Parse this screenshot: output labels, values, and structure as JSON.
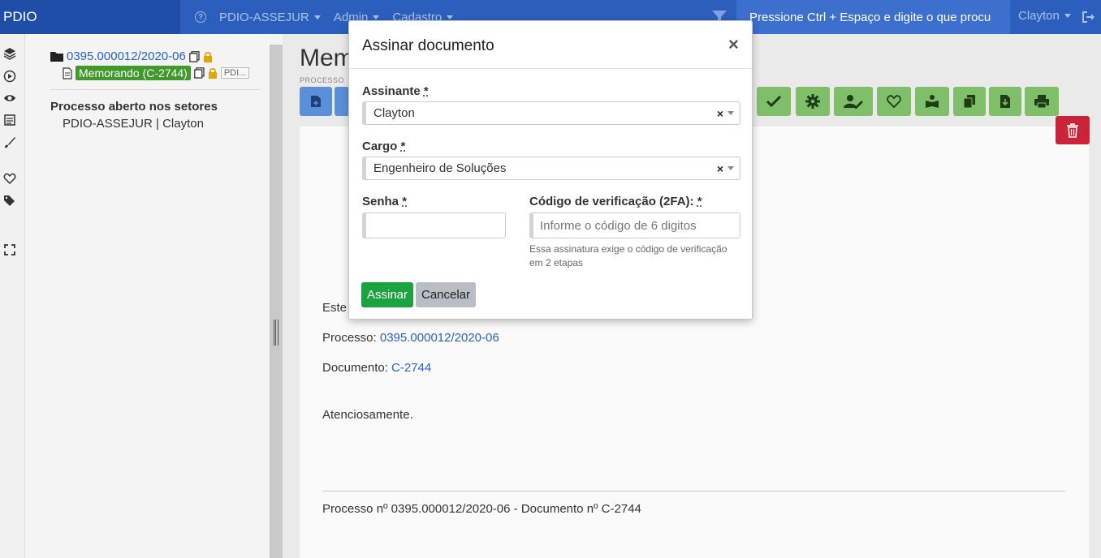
{
  "navbar": {
    "brand": "PDIO",
    "items": [
      {
        "label": "PDIO-ASSEJUR"
      },
      {
        "label": "Admin"
      },
      {
        "label": "Cadastro"
      }
    ],
    "search_text": "Pressione Ctrl + Espaço e digite o que procu",
    "user": "Clayton"
  },
  "tree": {
    "process_number": "0395.000012/2020-06",
    "document_label": "Memorando (C-2744)",
    "document_tag": "PDI...",
    "open_title": "Processo aberto nos setores",
    "sector": "PDIO-ASSEJUR | Clayton"
  },
  "main": {
    "title": "Mem",
    "subtitle": "PROCESSO",
    "doc": {
      "line_este": "Este",
      "process_label": "Processo: ",
      "process_value": "0395.000012/2020-06",
      "document_label": "Documento: ",
      "document_value": "C-2744",
      "closing": "Atenciosamente.",
      "footer": "Processo nº 0395.000012/2020-06 - Documento nº C-2744"
    }
  },
  "modal": {
    "title": "Assinar documento",
    "close": "×",
    "signer_label": "Assinante",
    "signer_value": "Clayton",
    "role_label": "Cargo",
    "role_value": "Engenheiro de Soluções",
    "password_label": "Senha",
    "code_label": "Código de verificação (2FA):",
    "code_placeholder": "Informe o código de 6 digitos",
    "help_text": "Essa assinatura exige o código de verificação em 2 etapas",
    "required_mark": "*",
    "clear_mark": "×",
    "sign_button": "Assinar",
    "cancel_button": "Cancelar"
  },
  "colors": {
    "navbar": "#2c5fbd",
    "brand": "#1f4ea8",
    "primary_green": "#1aa33e",
    "danger": "#c9243a",
    "link": "#2a62c9"
  },
  "icons": [
    "help-icon",
    "filter-icon",
    "logout-icon",
    "layers-icon",
    "play-icon",
    "eye-icon",
    "list-icon",
    "brush-icon",
    "heart-icon",
    "tags-icon",
    "expand-icon",
    "folder-icon",
    "file-icon",
    "copy-icon",
    "lock-icon",
    "check-icon",
    "gear-icon",
    "user-edit-icon",
    "book-reader-icon",
    "clipboard-icon",
    "download-icon",
    "print-icon",
    "trash-icon"
  ]
}
